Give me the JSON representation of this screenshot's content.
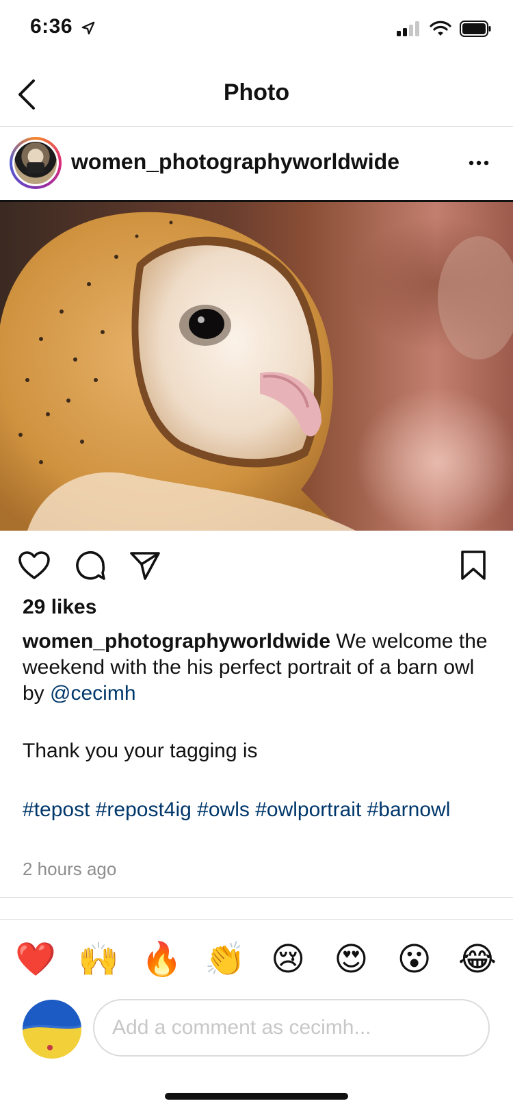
{
  "status_bar": {
    "time": "6:36"
  },
  "nav": {
    "title": "Photo"
  },
  "post": {
    "username": "women_photographyworldwide",
    "likes": "29 likes",
    "caption_user": "women_photographyworldwide",
    "caption_text": " We welcome the weekend with the his perfect portrait of a barn owl by ",
    "mention": "@cecimh",
    "thanks": "Thank you your tagging is",
    "hashtags": "#tepost #repost4ig #owls #owlportrait #barnowl",
    "time_ago": "2 hours ago"
  },
  "reactions": [
    "❤️",
    "🙌",
    "🔥",
    "👏",
    "😢",
    "😍",
    "😮",
    "😂"
  ],
  "comment": {
    "placeholder": "Add a comment as cecimh..."
  },
  "icons": {
    "back": "chevron-left-icon",
    "more": "more-horizontal-icon",
    "like": "heart-icon",
    "comment": "comment-bubble-icon",
    "share": "send-icon",
    "save": "bookmark-icon"
  },
  "colors": {
    "link": "#00376b",
    "muted": "#8e8e8e",
    "border": "#dbdbdb"
  }
}
